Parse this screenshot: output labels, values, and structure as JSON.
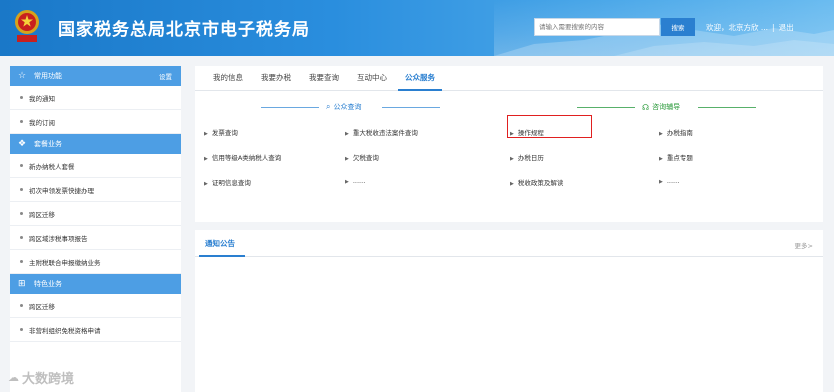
{
  "header": {
    "title": "国家税务总局北京市电子税务局",
    "search_placeholder": "请输入需要搜索的内容",
    "search_button": "搜索",
    "welcome": "欢迎，北京方欣 ...",
    "separator": "|",
    "logout": "退出"
  },
  "sidebar": {
    "common": {
      "label": "常用功能",
      "settings": "设置"
    },
    "common_items": [
      {
        "label": "我的通知"
      },
      {
        "label": "我的订阅"
      }
    ],
    "package": {
      "label": "套餐业务"
    },
    "package_items": [
      {
        "label": "新办纳税人套餐"
      },
      {
        "label": "初次申领发票快捷办理"
      },
      {
        "label": "跨区迁移"
      },
      {
        "label": "跨区域涉税事项报告"
      },
      {
        "label": "主附税联合申报缴纳业务"
      }
    ],
    "feature": {
      "label": "特色业务"
    },
    "feature_items": [
      {
        "label": "跨区迁移"
      },
      {
        "label": "非营利组织免税资格申请"
      }
    ]
  },
  "tabs": [
    {
      "label": "我的信息"
    },
    {
      "label": "我要办税"
    },
    {
      "label": "我要查询"
    },
    {
      "label": "互动中心"
    },
    {
      "label": "公众服务"
    }
  ],
  "public_query": {
    "title": "公众查询",
    "links": [
      "发票查询",
      "重大税收违法案件查询",
      "信用等级A类纳税人查询",
      "欠税查询",
      "证明信息查询",
      "......"
    ]
  },
  "consult": {
    "title": "咨询辅导",
    "links": [
      "操作规程",
      "办税指南",
      "办税日历",
      "重点专题",
      "税收政策及解读",
      "......"
    ]
  },
  "notice": {
    "title": "通知公告",
    "more": "更多>"
  },
  "watermark": "大数跨境",
  "colors": {
    "accent": "#2a7fd0",
    "sidebar_head": "#4d9ee4",
    "consult_green": "#2a9a3a",
    "highlight": "#e02020"
  }
}
